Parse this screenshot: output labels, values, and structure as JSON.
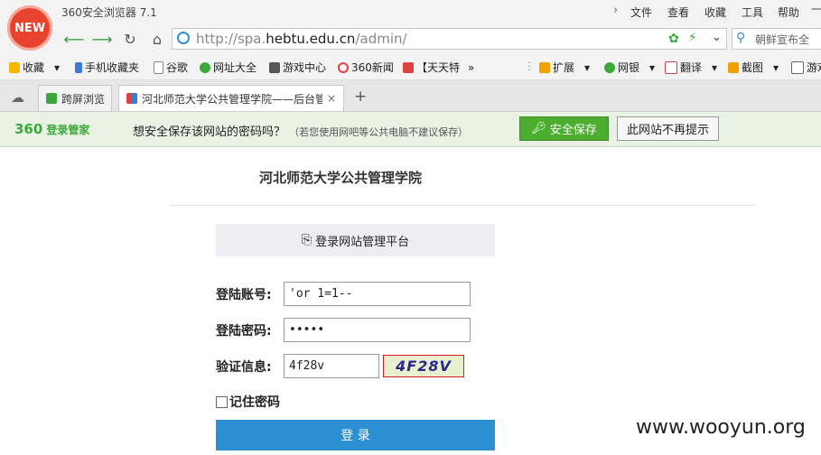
{
  "browser": {
    "logo_text": "NEW",
    "app_title": "360安全浏览器 7.1",
    "menu": [
      "文件",
      "查看",
      "收藏",
      "工具",
      "帮助"
    ],
    "url_prefix": "http://spa.",
    "url_domain": "hebtu.edu.cn",
    "url_path": "/admin/",
    "search_placeholder": "朝鲜宣布全",
    "bookmarks": [
      "收藏",
      "手机收藏夹",
      "谷歌",
      "网址大全",
      "游戏中心",
      "360新闻",
      "【天天特",
      "扩展",
      "网银",
      "翻译",
      "截图",
      "游戏"
    ],
    "tabs": [
      {
        "label": "跨屏浏览"
      },
      {
        "label": "河北师范大学公共管理学院——后台管",
        "close": "×"
      }
    ],
    "new_tab": "+"
  },
  "password_bar": {
    "brand": "360",
    "brand_sub": "登录管家",
    "question": "想安全保存该网站的密码吗？",
    "note": "（若您使用网吧等公共电脑不建议保存）",
    "save_button": "安全保存",
    "never_button": "此网站不再提示"
  },
  "page": {
    "title": "河北师范大学公共管理学院",
    "platform": "登录网站管理平台",
    "account_label": "登陆账号:",
    "account_value": "'or 1=1--",
    "password_label": "登陆密码:",
    "password_value": "•••••",
    "captcha_label": "验证信息:",
    "captcha_value": "4f28v",
    "captcha_image_text": "4F28V",
    "remember_label": "记住密码",
    "login_button": "登 录"
  },
  "watermark": "www.wooyun.org",
  "colors": {
    "accent": "#2b8fd1",
    "save_green": "#4cae2e",
    "logo_red": "#e8432e"
  }
}
